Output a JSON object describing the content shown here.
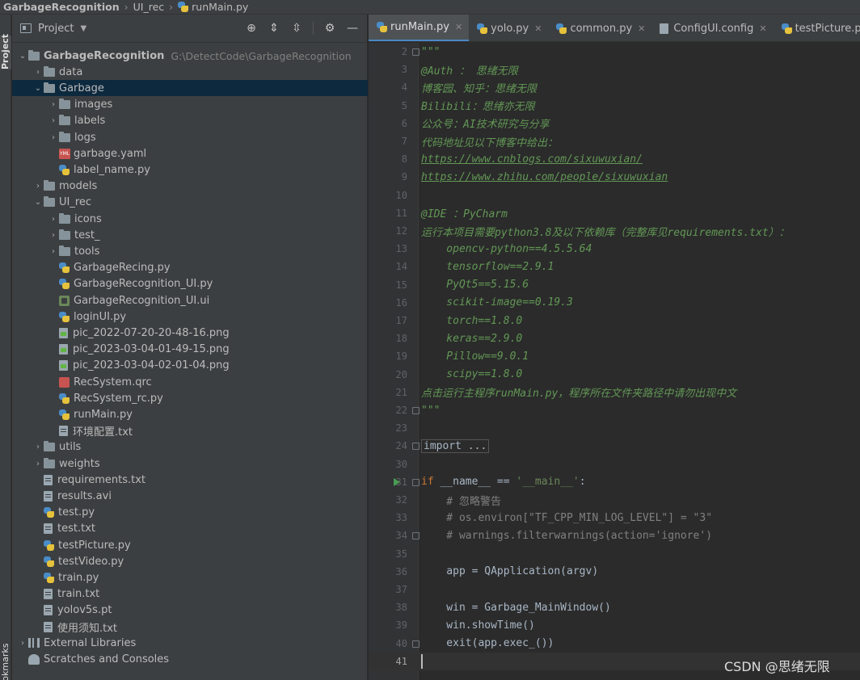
{
  "breadcrumb": {
    "items": [
      "GarbageRecognition",
      "UI_rec",
      "runMain.py"
    ]
  },
  "tool_strip": {
    "project": "Project",
    "bookmarks": "Bookmarks"
  },
  "project_panel": {
    "title": "Project"
  },
  "tree": [
    {
      "label": "GarbageRecognition",
      "hint": "G:\\DetectCode\\GarbageRecognition",
      "type": "folder",
      "depth": 0,
      "expanded": true,
      "root": true
    },
    {
      "label": "data",
      "type": "folder",
      "depth": 1,
      "expanded": false
    },
    {
      "label": "Garbage",
      "type": "folder",
      "depth": 1,
      "expanded": true,
      "selected": true
    },
    {
      "label": "images",
      "type": "folder",
      "depth": 2,
      "expanded": false
    },
    {
      "label": "labels",
      "type": "folder",
      "depth": 2,
      "expanded": false
    },
    {
      "label": "logs",
      "type": "folder",
      "depth": 2,
      "expanded": false
    },
    {
      "label": "garbage.yaml",
      "type": "yaml",
      "depth": 2
    },
    {
      "label": "label_name.py",
      "type": "py",
      "depth": 2
    },
    {
      "label": "models",
      "type": "folder",
      "depth": 1,
      "expanded": false
    },
    {
      "label": "UI_rec",
      "type": "folder",
      "depth": 1,
      "expanded": true
    },
    {
      "label": "icons",
      "type": "folder",
      "depth": 2,
      "expanded": false
    },
    {
      "label": "test_",
      "type": "folder",
      "depth": 2,
      "expanded": false
    },
    {
      "label": "tools",
      "type": "folder",
      "depth": 2,
      "expanded": false
    },
    {
      "label": "GarbageRecing.py",
      "type": "py",
      "depth": 2
    },
    {
      "label": "GarbageRecognition_UI.py",
      "type": "py",
      "depth": 2
    },
    {
      "label": "GarbageRecognition_UI.ui",
      "type": "ui",
      "depth": 2
    },
    {
      "label": "loginUI.py",
      "type": "py",
      "depth": 2
    },
    {
      "label": "pic_2022-07-20-20-48-16.png",
      "type": "img",
      "depth": 2
    },
    {
      "label": "pic_2023-03-04-01-49-15.png",
      "type": "img",
      "depth": 2
    },
    {
      "label": "pic_2023-03-04-02-01-04.png",
      "type": "img",
      "depth": 2
    },
    {
      "label": "RecSystem.qrc",
      "type": "qrc",
      "depth": 2
    },
    {
      "label": "RecSystem_rc.py",
      "type": "py",
      "depth": 2
    },
    {
      "label": "runMain.py",
      "type": "py",
      "depth": 2
    },
    {
      "label": "环境配置.txt",
      "type": "txt",
      "depth": 2
    },
    {
      "label": "utils",
      "type": "folder",
      "depth": 1,
      "expanded": false
    },
    {
      "label": "weights",
      "type": "folder",
      "depth": 1,
      "expanded": false
    },
    {
      "label": "requirements.txt",
      "type": "txt",
      "depth": 1
    },
    {
      "label": "results.avi",
      "type": "txt",
      "depth": 1
    },
    {
      "label": "test.py",
      "type": "py",
      "depth": 1
    },
    {
      "label": "test.txt",
      "type": "txt",
      "depth": 1
    },
    {
      "label": "testPicture.py",
      "type": "py",
      "depth": 1
    },
    {
      "label": "testVideo.py",
      "type": "py",
      "depth": 1
    },
    {
      "label": "train.py",
      "type": "py",
      "depth": 1
    },
    {
      "label": "train.txt",
      "type": "txt",
      "depth": 1
    },
    {
      "label": "yolov5s.pt",
      "type": "txt",
      "depth": 1
    },
    {
      "label": "使用须知.txt",
      "type": "txt",
      "depth": 1
    },
    {
      "label": "External Libraries",
      "type": "lib",
      "depth": 0,
      "expanded": false
    },
    {
      "label": "Scratches and Consoles",
      "type": "scratch",
      "depth": 0
    }
  ],
  "tabs": [
    {
      "label": "runMain.py",
      "icon": "py",
      "active": true
    },
    {
      "label": "yolo.py",
      "icon": "py"
    },
    {
      "label": "common.py",
      "icon": "py"
    },
    {
      "label": "ConfigUI.config",
      "icon": "config"
    },
    {
      "label": "testPicture.py",
      "icon": "py"
    }
  ],
  "code_lines": [
    {
      "n": "2",
      "fold": true,
      "parts": [
        [
          "doc",
          "\"\"\""
        ]
      ]
    },
    {
      "n": "3",
      "parts": [
        [
          "doc",
          "@Auth ： 思绪无限"
        ]
      ]
    },
    {
      "n": "4",
      "parts": [
        [
          "doc",
          "博客园、知乎：思绪无限"
        ]
      ]
    },
    {
      "n": "5",
      "parts": [
        [
          "doc",
          "Bilibili：思绪亦无限"
        ]
      ]
    },
    {
      "n": "6",
      "parts": [
        [
          "doc",
          "公众号：AI技术研究与分享"
        ]
      ]
    },
    {
      "n": "7",
      "parts": [
        [
          "doc",
          "代码地址见以下博客中给出："
        ]
      ]
    },
    {
      "n": "8",
      "parts": [
        [
          "doc-link",
          "https://www.cnblogs.com/sixuwuxian/"
        ]
      ]
    },
    {
      "n": "9",
      "parts": [
        [
          "doc-link",
          "https://www.zhihu.com/people/sixuwuxian"
        ]
      ]
    },
    {
      "n": "10",
      "parts": []
    },
    {
      "n": "11",
      "parts": [
        [
          "doc",
          "@IDE ：PyCharm"
        ]
      ]
    },
    {
      "n": "12",
      "parts": [
        [
          "doc",
          "运行本项目需要python3.8及以下依赖库（完整库见requirements.txt）："
        ]
      ]
    },
    {
      "n": "13",
      "parts": [
        [
          "doc",
          "    opencv-python==4.5.5.64"
        ]
      ]
    },
    {
      "n": "14",
      "parts": [
        [
          "doc",
          "    tensorflow==2.9.1"
        ]
      ]
    },
    {
      "n": "15",
      "parts": [
        [
          "doc",
          "    PyQt5==5.15.6"
        ]
      ]
    },
    {
      "n": "16",
      "parts": [
        [
          "doc",
          "    scikit-image==0.19.3"
        ]
      ]
    },
    {
      "n": "17",
      "parts": [
        [
          "doc",
          "    torch==1.8.0"
        ]
      ]
    },
    {
      "n": "18",
      "parts": [
        [
          "doc",
          "    keras==2.9.0"
        ]
      ]
    },
    {
      "n": "19",
      "parts": [
        [
          "doc",
          "    Pillow==9.0.1"
        ]
      ]
    },
    {
      "n": "20",
      "parts": [
        [
          "doc",
          "    scipy==1.8.0"
        ]
      ]
    },
    {
      "n": "21",
      "parts": [
        [
          "doc",
          "点击运行主程序runMain.py，程序所在文件夹路径中请勿出现中文"
        ]
      ]
    },
    {
      "n": "22",
      "fold": true,
      "parts": [
        [
          "doc",
          "\"\"\""
        ]
      ]
    },
    {
      "n": "23",
      "parts": []
    },
    {
      "n": "24",
      "fold": true,
      "parts": [
        [
          "foldbox",
          "import ..."
        ]
      ]
    },
    {
      "n": "30",
      "parts": []
    },
    {
      "n": "31",
      "fold": true,
      "run": true,
      "parts": [
        [
          "kw",
          "if "
        ],
        [
          "",
          "__name__ == "
        ],
        [
          "str",
          "'__main__'"
        ],
        [
          "",
          ":"
        ]
      ]
    },
    {
      "n": "32",
      "parts": [
        [
          "cmt",
          "    # 忽略警告"
        ]
      ]
    },
    {
      "n": "33",
      "parts": [
        [
          "cmt",
          "    # os.environ[\"TF_CPP_MIN_LOG_LEVEL\"] = \"3\""
        ]
      ]
    },
    {
      "n": "34",
      "fold": true,
      "parts": [
        [
          "cmt",
          "    # warnings.filterwarnings(action='ignore')"
        ]
      ]
    },
    {
      "n": "35",
      "parts": []
    },
    {
      "n": "36",
      "parts": [
        [
          "",
          "    app = QApplication(argv)"
        ]
      ]
    },
    {
      "n": "37",
      "parts": []
    },
    {
      "n": "38",
      "parts": [
        [
          "",
          "    win = Garbage_MainWindow()"
        ]
      ]
    },
    {
      "n": "39",
      "parts": [
        [
          "",
          "    win.showTime()"
        ]
      ]
    },
    {
      "n": "40",
      "fold": true,
      "parts": [
        [
          "",
          "    exit(app.exec_())"
        ]
      ]
    },
    {
      "n": "41",
      "current": true,
      "caret": true,
      "parts": []
    }
  ],
  "watermark": "CSDN @思绪无限"
}
